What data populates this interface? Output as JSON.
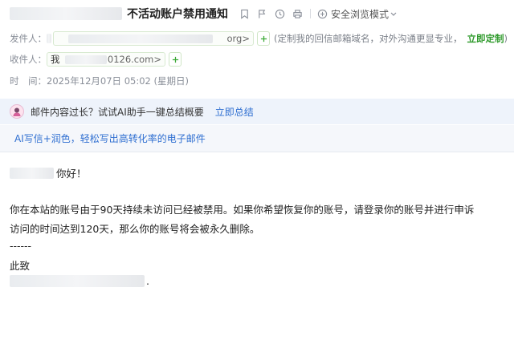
{
  "header": {
    "subject": "不活动账户禁用通知",
    "safe_mode_label": "安全浏览模式",
    "sender_label": "发件人：",
    "sender_address_visible": "org>",
    "sender_hint": "(定制我的回信邮箱域名，对外沟通更显专业，",
    "sender_hint_link": "立即定制",
    "sender_hint_close": ")",
    "recipient_label": "收件人：",
    "recipient_name": "我",
    "recipient_address_visible": "0126.com>",
    "time_label": "时　间：",
    "time_value": "2025年12月07日 05:02 (星期日)"
  },
  "ai_bar": {
    "text": "邮件内容过长？试试AI助手一键总结概要",
    "link": "立即总结"
  },
  "promo": {
    "text": "AI写信+润色，轻松写出高转化率的电子邮件"
  },
  "body": {
    "greeting": "你好！",
    "paragraph_line1": "你在本站的账号由于90天持续未访问已经被禁用。如果你希望恢复你的账号，请登录你的账号并进行申诉",
    "paragraph_line2": "访问的时间达到120天，那么你的账号将会被永久删除。",
    "separator": "------",
    "closing": "此致",
    "signature_trail": "."
  },
  "icons": {
    "bookmark": "bookmark-icon",
    "flag": "flag-icon",
    "clock": "clock-icon",
    "print": "print-icon",
    "shield": "shield-icon",
    "chevron": "chevron-down-icon",
    "plus": "plus-icon",
    "avatar": "ai-avatar-icon"
  },
  "colors": {
    "green_link": "#2f9a2c",
    "blue_link": "#2f6fd1",
    "ai_bar_bg": "#eef3fb"
  }
}
